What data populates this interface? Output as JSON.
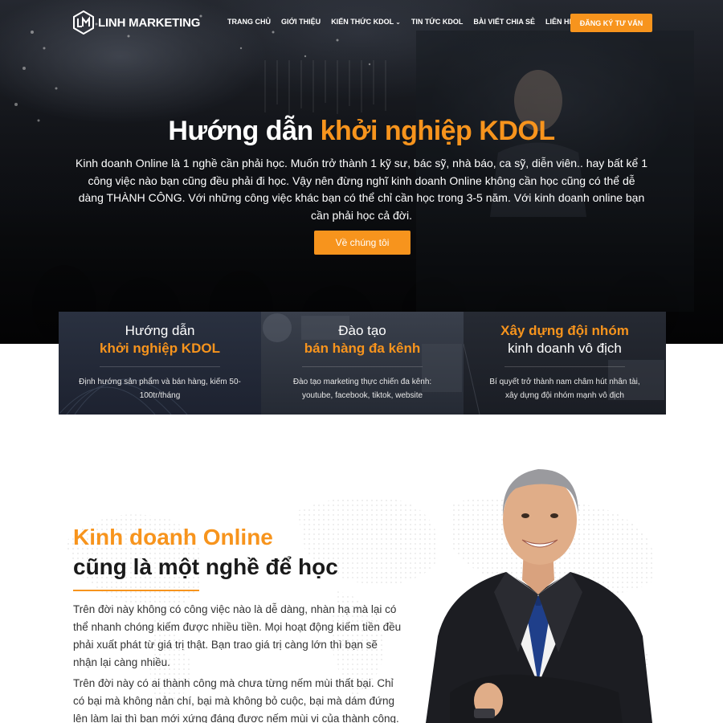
{
  "header": {
    "logo_text": "LINH MARKETING",
    "nav": [
      {
        "label": "TRANG CHỦ",
        "has_dropdown": false
      },
      {
        "label": "GIỚI THIỆU",
        "has_dropdown": false
      },
      {
        "label": "KIẾN THỨC KDOL",
        "has_dropdown": true
      },
      {
        "label": "TIN TỨC KDOL",
        "has_dropdown": false
      },
      {
        "label": "BÀI VIẾT CHIA SẺ",
        "has_dropdown": false
      },
      {
        "label": "LIÊN HỆ",
        "has_dropdown": false
      }
    ],
    "cta_label": "ĐĂNG KÝ TƯ VẤN"
  },
  "hero": {
    "title_plain": "Hướng dẫn",
    "title_accent": "khởi nghiệp KDOL",
    "description": "Kinh doanh Online là 1 nghề cần phải học. Muốn trở thành 1 kỹ sư, bác sỹ, nhà báo, ca sỹ, diễn viên.. hay bất kể 1 công việc nào bạn cũng đều phải đi học. Vậy nên đừng nghĩ kinh doanh Online không cần học cũng có thể dễ dàng THÀNH CÔNG. Với những công việc khác bạn có thể chỉ cần học trong 3-5 năm. Với kinh doanh online bạn cần phải học cả đời.",
    "button_label": "Về chúng tôi"
  },
  "cards": [
    {
      "line1": "Hướng dẫn",
      "line2": "khởi nghiệp KDOL",
      "description": "Định hướng sản phẩm và bán hàng, kiếm 50-100tr/tháng"
    },
    {
      "line1": "Đào tạo",
      "line2": "bán hàng đa kênh",
      "description": "Đào tạo marketing thực chiến đa kênh: youtube, facebook, tiktok, website"
    },
    {
      "line1": "Xây dựng đội nhóm",
      "line2": "kinh doanh vô địch",
      "description": "Bí quyết trở thành nam châm hút nhân tài, xây dựng đội nhóm mạnh vô địch"
    }
  ],
  "section": {
    "title_accent": "Kinh doanh Online",
    "title_plain": "cũng là một nghề để học",
    "paragraph1": "Trên đời này không có công việc nào là dễ dàng, nhàn hạ mà lại có thể nhanh chóng kiếm được nhiều tiền. Mọi hoạt động kiếm tiền đều phải xuất phát từ giá trị thật. Bạn trao giá trị càng lớn thì bạn sẽ nhận lại càng nhiều.",
    "paragraph2": "Trên đời này có ai thành công mà chưa từng nếm mùi thất bại. Chỉ có bại mà không nản chí, bại mà không bỏ cuộc, bại mà dám đứng lên làm lại thì bạn mới xứng đáng được nếm mùi vị của thành công."
  },
  "colors": {
    "accent": "#f7941d",
    "dark_text": "#1a1a1a"
  }
}
